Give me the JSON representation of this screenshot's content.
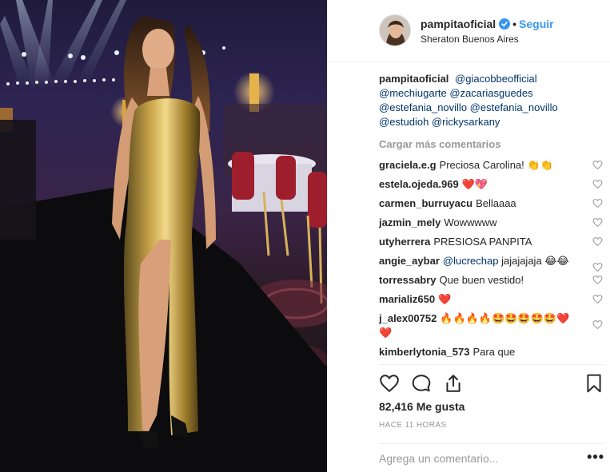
{
  "post": {
    "username": "pampitaoficial",
    "location": "Sheraton Buenos Aires",
    "follow_label": "Seguir",
    "separator": "•",
    "caption_user": "pampitaoficial",
    "caption_mentions": [
      "@giacobbeofficial",
      "@mechiugarte",
      "@zacariasguedes",
      "@estefania_novillo",
      "@estefania_novillo",
      "@estudioh",
      "@rickysarkany"
    ]
  },
  "load_more": "Cargar más comentarios",
  "comments": [
    {
      "user": "graciela.e.g",
      "text": "Preciosa Carolina! 👏👏"
    },
    {
      "user": "estela.ojeda.969",
      "text": "❤️💖"
    },
    {
      "user": "carmen_burruyacu",
      "text": "Bellaaaa"
    },
    {
      "user": "jazmin_mely",
      "text": "Wowwwww"
    },
    {
      "user": "utyherrera",
      "text": "PRESIOSA PANPITA"
    },
    {
      "user": "angie_aybar",
      "mention": "@lucrechap",
      "text": "jajajajaja 😂😂"
    },
    {
      "user": "torressabry",
      "text": "Que buen vestido!"
    },
    {
      "user": "marializ650",
      "text": "❤️"
    },
    {
      "user": "j_alex00752",
      "text": "🔥🔥🔥🔥🤩🤩🤩🤩🤩❤️❤️"
    },
    {
      "user": "kimberlytonia_573",
      "text": "Para que"
    }
  ],
  "icons": {
    "like": "heart-outline-icon",
    "comment": "comment-bubble-icon",
    "share": "share-upload-icon",
    "save": "bookmark-icon",
    "verified": "verified-badge-icon",
    "comment_like": "heart-small-icon"
  },
  "likes_text": "82,416 Me gusta",
  "timestamp": "HACE 11 HORAS",
  "add_comment_placeholder": "Agrega un comentario...",
  "options_label": "•••",
  "colors": {
    "link": "#3897f0",
    "mention": "#003569",
    "muted": "#999999",
    "text": "#262626"
  }
}
